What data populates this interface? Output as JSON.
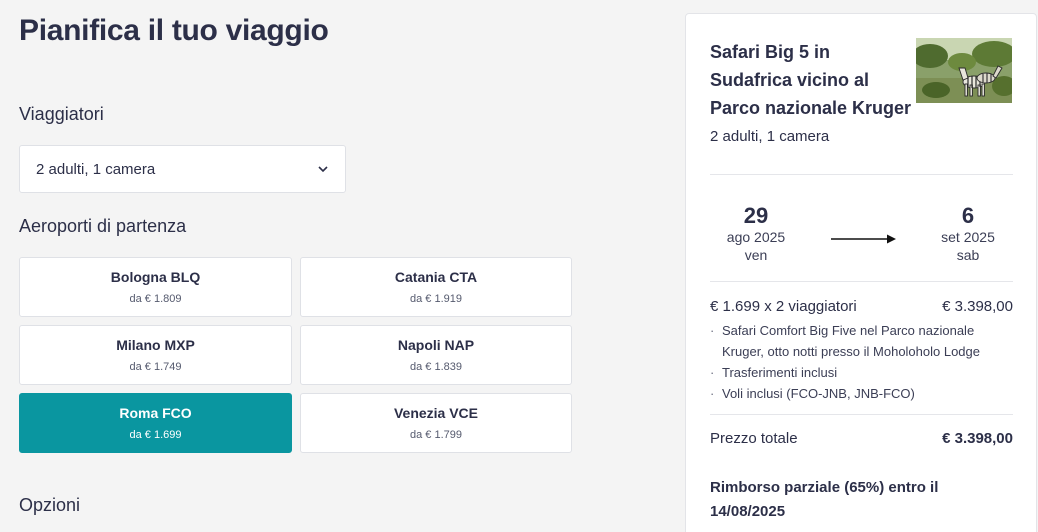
{
  "page": {
    "title": "Pianifica il tuo viaggio"
  },
  "travelers": {
    "label": "Viaggiatori",
    "value": "2 adulti, 1 camera"
  },
  "departure": {
    "label": "Aeroporti di partenza",
    "airports": [
      {
        "name": "Bologna BLQ",
        "price": "da € 1.809",
        "selected": false
      },
      {
        "name": "Catania CTA",
        "price": "da € 1.919",
        "selected": false
      },
      {
        "name": "Milano MXP",
        "price": "da € 1.749",
        "selected": false
      },
      {
        "name": "Napoli NAP",
        "price": "da € 1.839",
        "selected": false
      },
      {
        "name": "Roma FCO",
        "price": "da € 1.699",
        "selected": true
      },
      {
        "name": "Venezia VCE",
        "price": "da € 1.799",
        "selected": false
      }
    ]
  },
  "options": {
    "label": "Opzioni"
  },
  "summary": {
    "title": "Safari Big 5 in Sudafrica vicino al Parco nazionale Kruger",
    "guests": "2 adulti, 1 camera",
    "start": {
      "day": "29",
      "month_year": "ago 2025",
      "weekday": "ven"
    },
    "end": {
      "day": "6",
      "month_year": "set 2025",
      "weekday": "sab"
    },
    "price_line": {
      "label": "€ 1.699 x 2 viaggiatori",
      "amount": "€ 3.398,00"
    },
    "inclusions": [
      "Safari Comfort Big Five nel Parco nazionale Kruger, otto notti presso il Moholoholo Lodge",
      "Trasferimenti inclusi",
      "Voli inclusi (FCO-JNB, JNB-FCO)"
    ],
    "total": {
      "label": "Prezzo totale",
      "amount": "€ 3.398,00"
    },
    "refund": "Rimborso parziale (65%) entro il 14/08/2025"
  },
  "colors": {
    "accent": "#0a96a0",
    "text": "#2c2f48",
    "background": "#f4f4f4"
  },
  "icons": {
    "travelers_dropdown": "chevron-down-icon",
    "date_arrow": "arrow-right-icon"
  }
}
